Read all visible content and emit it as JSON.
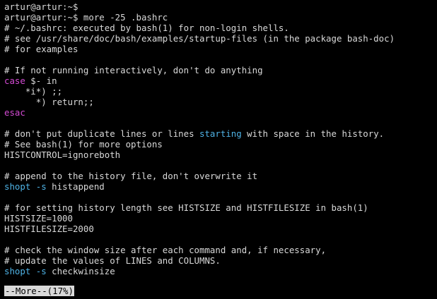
{
  "terminal": {
    "lines": [
      [
        {
          "text": "artur@artur:~$",
          "style": "normal"
        }
      ],
      [
        {
          "text": "artur@artur:~$ more -25 .bashrc",
          "style": "normal"
        }
      ],
      [
        {
          "text": "# ~/.bashrc: executed by bash(1) for non-login shells.",
          "style": "normal"
        }
      ],
      [
        {
          "text": "# see /usr/share/doc/bash/examples/startup-files (in the package bash-doc)",
          "style": "normal"
        }
      ],
      [
        {
          "text": "# for examples",
          "style": "normal"
        }
      ],
      [
        {
          "text": "",
          "style": "normal"
        }
      ],
      [
        {
          "text": "# If not running interactively, don't do anything",
          "style": "normal"
        }
      ],
      [
        {
          "text": "case",
          "style": "keyword"
        },
        {
          "text": " $- in",
          "style": "normal"
        }
      ],
      [
        {
          "text": "    *i*) ;;",
          "style": "normal"
        }
      ],
      [
        {
          "text": "      *) return;;",
          "style": "normal"
        }
      ],
      [
        {
          "text": "esac",
          "style": "keyword"
        }
      ],
      [
        {
          "text": "",
          "style": "normal"
        }
      ],
      [
        {
          "text": "# don't put duplicate lines or lines ",
          "style": "normal"
        },
        {
          "text": "starting",
          "style": "emph"
        },
        {
          "text": " with space in the history.",
          "style": "normal"
        }
      ],
      [
        {
          "text": "# See bash(1) for more options",
          "style": "normal"
        }
      ],
      [
        {
          "text": "HISTCONTROL=ignoreboth",
          "style": "normal"
        }
      ],
      [
        {
          "text": "",
          "style": "normal"
        }
      ],
      [
        {
          "text": "# append to the history file, don't overwrite it",
          "style": "normal"
        }
      ],
      [
        {
          "text": "shopt -s",
          "style": "builtin"
        },
        {
          "text": " histappend",
          "style": "normal"
        }
      ],
      [
        {
          "text": "",
          "style": "normal"
        }
      ],
      [
        {
          "text": "# for setting history length see HISTSIZE and HISTFILESIZE in bash(1)",
          "style": "normal"
        }
      ],
      [
        {
          "text": "HISTSIZE=1000",
          "style": "normal"
        }
      ],
      [
        {
          "text": "HISTFILESIZE=2000",
          "style": "normal"
        }
      ],
      [
        {
          "text": "",
          "style": "normal"
        }
      ],
      [
        {
          "text": "# check the window size after each command and, if necessary,",
          "style": "normal"
        }
      ],
      [
        {
          "text": "# update the values of LINES and COLUMNS.",
          "style": "normal"
        }
      ],
      [
        {
          "text": "shopt -s",
          "style": "builtin"
        },
        {
          "text": " checkwinsize",
          "style": "normal"
        }
      ],
      [
        {
          "text": "",
          "style": "normal"
        }
      ]
    ],
    "more_prompt": "--More--(17%)"
  },
  "colors": {
    "background": "#000000",
    "foreground": "#d9d9d9",
    "keyword": "#d34ad3",
    "builtin": "#4fb3e6",
    "emph": "#4fb3e6"
  }
}
